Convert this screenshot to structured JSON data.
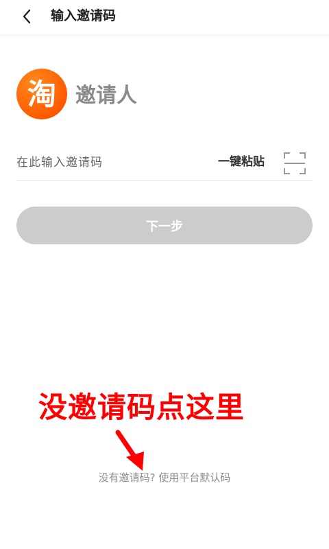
{
  "header": {
    "title": "输入邀请码",
    "back_icon": "chevron-left-icon"
  },
  "logo": {
    "glyph": "淘",
    "color": "#ff6a00"
  },
  "inviter": {
    "label": "邀请人"
  },
  "invite_input": {
    "value": "",
    "placeholder": "在此输入邀请码"
  },
  "paste_button": {
    "label": "一键粘贴"
  },
  "scan_button": {
    "icon": "scan-frame-icon"
  },
  "next_button": {
    "label": "下一步",
    "color": "#cccccc"
  },
  "annotation": {
    "text": "没邀请码点这里",
    "color": "#ff0000"
  },
  "default_code_link": {
    "label": "没有邀请码? 使用平台默认码"
  }
}
